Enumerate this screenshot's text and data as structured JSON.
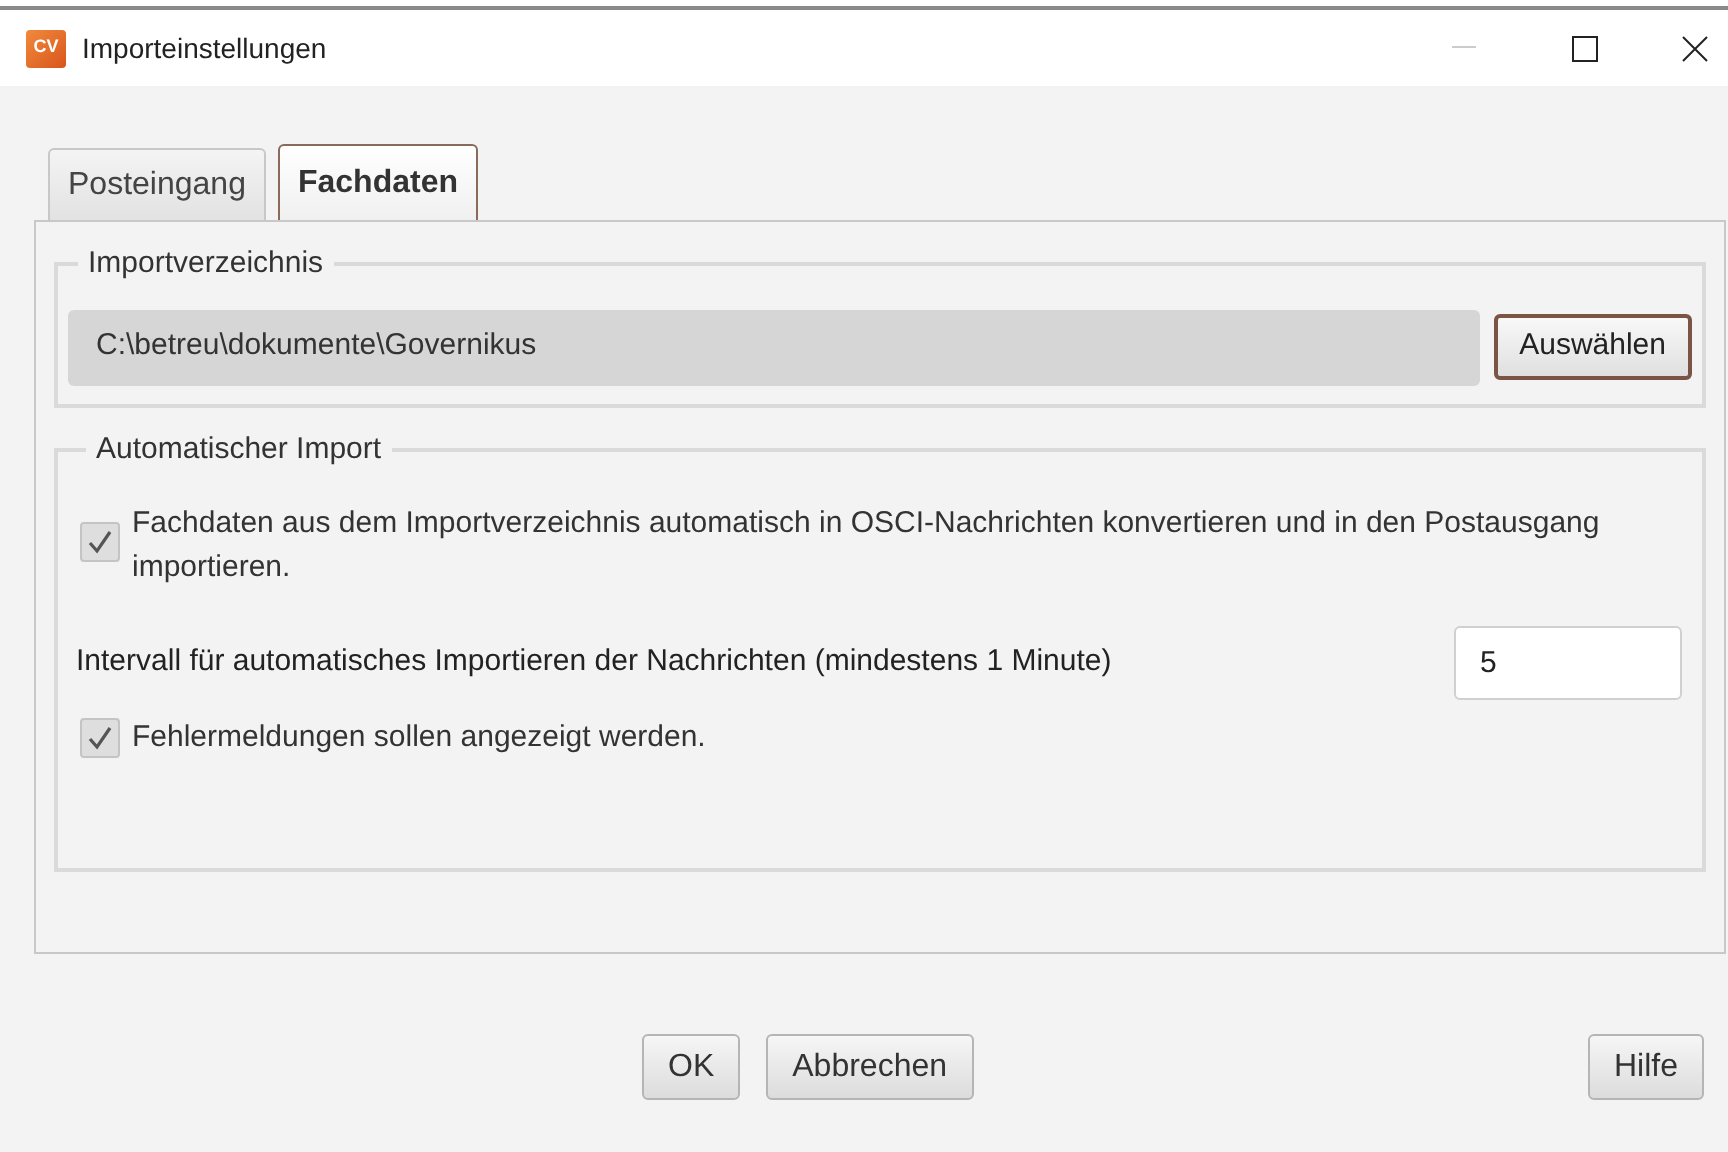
{
  "window": {
    "title": "Importeinstellungen",
    "app_icon": "CV"
  },
  "tabs": [
    {
      "label": "Posteingang",
      "selected": false
    },
    {
      "label": "Fachdaten",
      "selected": true
    }
  ],
  "import_directory": {
    "legend": "Importverzeichnis",
    "path": "C:\\betreu\\dokumente\\Governikus",
    "button": "Auswählen"
  },
  "automatic_import": {
    "legend": "Automatischer Import",
    "convert": {
      "label": "Fachdaten aus dem Importverzeichnis automatisch in OSCI-Nachrichten konvertieren und in den Postausgang importieren.",
      "checked": true
    },
    "interval": {
      "label": "Intervall für automatisches Importieren der Nachrichten (mindestens 1 Minute)",
      "value": "5"
    },
    "show_errors": {
      "label": "Fehlermeldungen sollen angezeigt werden.",
      "checked": true
    }
  },
  "buttons": {
    "ok": "OK",
    "cancel": "Abbrechen",
    "help": "Hilfe"
  }
}
